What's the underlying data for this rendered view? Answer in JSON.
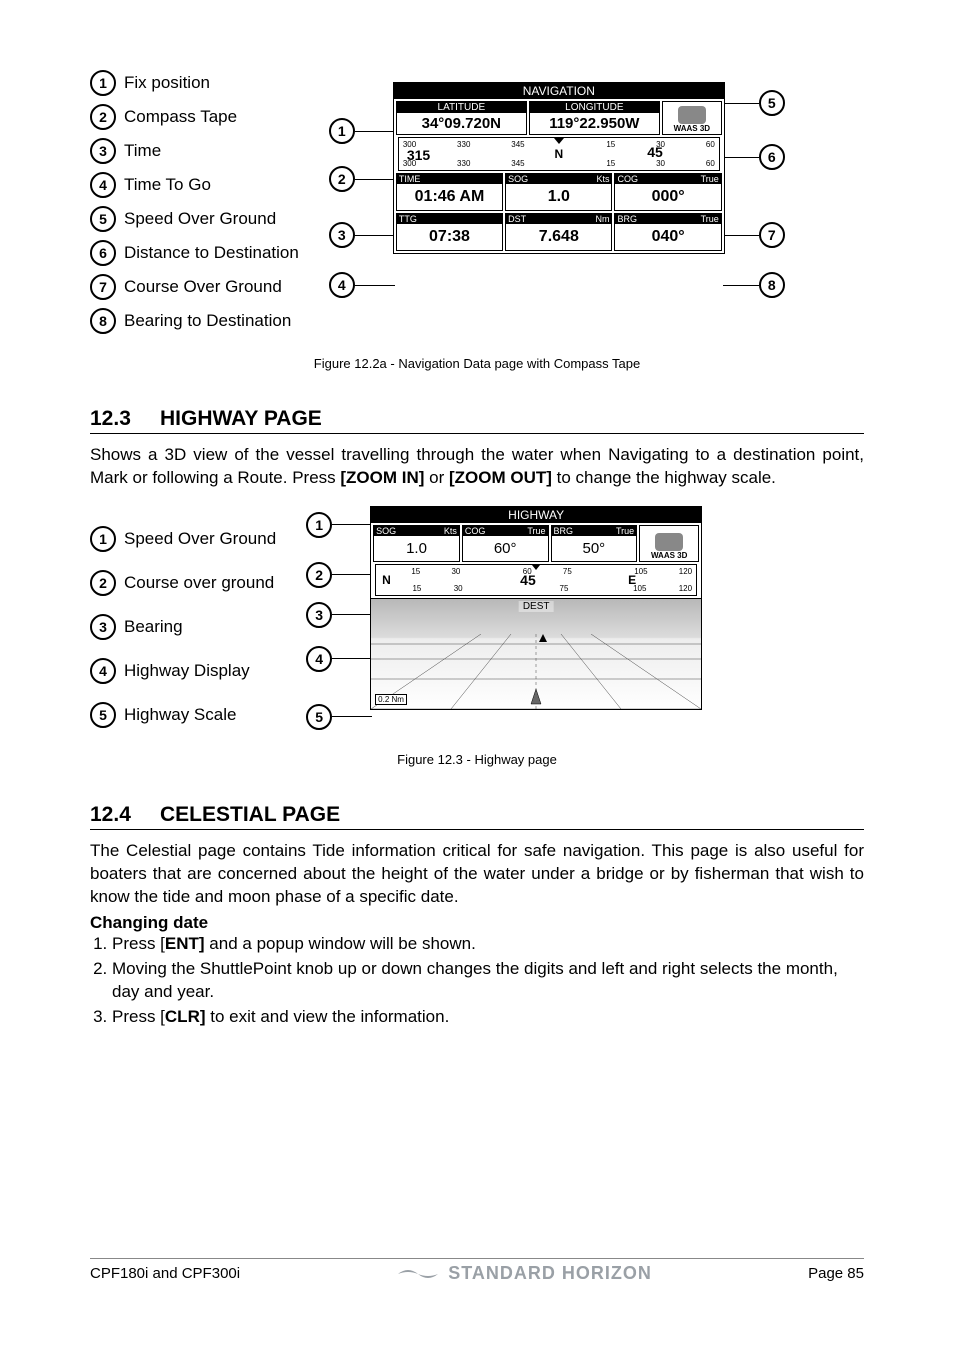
{
  "fig1": {
    "legend": [
      "Fix position",
      "Compass Tape",
      "Time",
      "Time To Go",
      "Speed Over Ground",
      "Distance to Destination",
      "Course Over Ground",
      "Bearing to Destination"
    ],
    "caption": "Figure 12.2a - Navigation Data page with Compass Tape",
    "screen": {
      "title": "NAVIGATION",
      "lat_label": "LATITUDE",
      "lat_value": "34°09.720N",
      "lon_label": "LONGITUDE",
      "lon_value": "119°22.950W",
      "waas": "WAAS  3D",
      "compass_ticks_top": [
        "300",
        "330",
        "345",
        "",
        "15",
        "30",
        "60"
      ],
      "compass_ticks_bottom": [
        "300",
        "330",
        "345",
        "",
        "15",
        "30",
        "60"
      ],
      "compass_big": "315",
      "compass_mark": "45",
      "compass_n": "N",
      "row1": [
        {
          "h": [
            "TIME",
            ""
          ],
          "v": "01:46 AM"
        },
        {
          "h": [
            "SOG",
            "Kts"
          ],
          "v": "1.0"
        },
        {
          "h": [
            "COG",
            "True"
          ],
          "v": "000°"
        }
      ],
      "row2": [
        {
          "h": [
            "TTG",
            ""
          ],
          "v": "07:38"
        },
        {
          "h": [
            "DST",
            "Nm"
          ],
          "v": "7.648"
        },
        {
          "h": [
            "BRG",
            "True"
          ],
          "v": "040°"
        }
      ]
    }
  },
  "section1": {
    "num": "12.3",
    "title": "HIGHWAY PAGE"
  },
  "para1": {
    "a": "Shows a 3D view of the vessel travelling through the water when Navigating to a destination point, Mark or following a Route. Press ",
    "b": "[ZOOM IN]",
    "c": " or ",
    "d": "[ZOOM OUT]",
    "e": " to change the highway scale."
  },
  "fig2": {
    "legend": [
      "Speed Over Ground",
      "Course over ground",
      "Bearing",
      "Highway Display",
      "Highway Scale"
    ],
    "caption": "Figure 12.3 -  Highway page",
    "screen": {
      "title": "HIGHWAY",
      "row": [
        {
          "h": [
            "SOG",
            "Kts"
          ],
          "v": "1.0"
        },
        {
          "h": [
            "COG",
            "True"
          ],
          "v": "60°"
        },
        {
          "h": [
            "BRG",
            "True"
          ],
          "v": "50°"
        }
      ],
      "waas": "WAAS  3D",
      "compass_ticks_top": [
        "",
        "15",
        "30",
        "",
        "60",
        "75",
        "",
        "105",
        "120"
      ],
      "compass_ticks_bottom": [
        "",
        "15",
        "30",
        "",
        "",
        "75",
        "",
        "105",
        "120"
      ],
      "compass_n": "N",
      "compass_big": "45",
      "compass_e": "E",
      "dest": "DEST",
      "scale": "0.2 Nm"
    }
  },
  "section2": {
    "num": "12.4",
    "title": "CELESTIAL PAGE"
  },
  "para2": "The Celestial page contains Tide information critical for safe navigation. This page is also useful for boaters that are concerned about the height of the water under a bridge or by fisherman that wish to know the tide and moon phase of a specific date.",
  "changing": "Changing date",
  "steps": {
    "s1a": "Press [",
    "s1b": "ENT]",
    "s1c": " and a popup window will be shown.",
    "s2": "Moving the ShuttlePoint knob up or down changes the digits and left and right selects the month, day and year.",
    "s3a": "Press [",
    "s3b": "CLR]",
    "s3c": " to exit and view the information."
  },
  "footer": {
    "left": "CPF180i and CPF300i",
    "brand": "STANDARD HORIZON",
    "right": "Page 85"
  }
}
